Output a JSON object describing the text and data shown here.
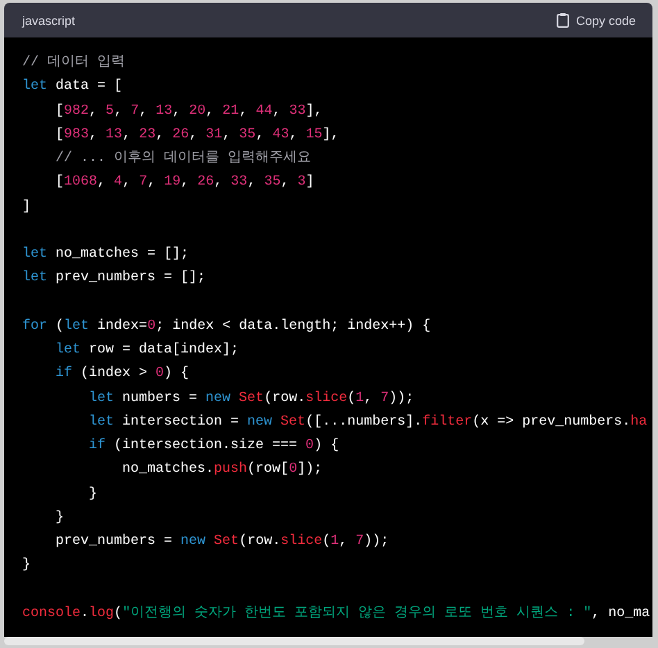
{
  "code_block": {
    "language": "javascript",
    "copy_button": "Copy code",
    "lines": [
      {
        "kind": "code",
        "tokens": [
          {
            "kind": "comment",
            "text": "// 데이터 입력"
          }
        ]
      },
      {
        "kind": "code",
        "tokens": [
          {
            "kind": "keyword",
            "text": "let"
          },
          {
            "kind": "plain",
            "text": " data = ["
          }
        ]
      },
      {
        "kind": "code",
        "tokens": [
          {
            "kind": "plain",
            "text": "    ["
          },
          {
            "kind": "number",
            "text": "982"
          },
          {
            "kind": "plain",
            "text": ", "
          },
          {
            "kind": "number",
            "text": "5"
          },
          {
            "kind": "plain",
            "text": ", "
          },
          {
            "kind": "number",
            "text": "7"
          },
          {
            "kind": "plain",
            "text": ", "
          },
          {
            "kind": "number",
            "text": "13"
          },
          {
            "kind": "plain",
            "text": ", "
          },
          {
            "kind": "number",
            "text": "20"
          },
          {
            "kind": "plain",
            "text": ", "
          },
          {
            "kind": "number",
            "text": "21"
          },
          {
            "kind": "plain",
            "text": ", "
          },
          {
            "kind": "number",
            "text": "44"
          },
          {
            "kind": "plain",
            "text": ", "
          },
          {
            "kind": "number",
            "text": "33"
          },
          {
            "kind": "plain",
            "text": "],"
          }
        ]
      },
      {
        "kind": "code",
        "tokens": [
          {
            "kind": "plain",
            "text": "    ["
          },
          {
            "kind": "number",
            "text": "983"
          },
          {
            "kind": "plain",
            "text": ", "
          },
          {
            "kind": "number",
            "text": "13"
          },
          {
            "kind": "plain",
            "text": ", "
          },
          {
            "kind": "number",
            "text": "23"
          },
          {
            "kind": "plain",
            "text": ", "
          },
          {
            "kind": "number",
            "text": "26"
          },
          {
            "kind": "plain",
            "text": ", "
          },
          {
            "kind": "number",
            "text": "31"
          },
          {
            "kind": "plain",
            "text": ", "
          },
          {
            "kind": "number",
            "text": "35"
          },
          {
            "kind": "plain",
            "text": ", "
          },
          {
            "kind": "number",
            "text": "43"
          },
          {
            "kind": "plain",
            "text": ", "
          },
          {
            "kind": "number",
            "text": "15"
          },
          {
            "kind": "plain",
            "text": "],"
          }
        ]
      },
      {
        "kind": "code",
        "tokens": [
          {
            "kind": "comment",
            "text": "    // ... 이후의 데이터를 입력해주세요"
          }
        ]
      },
      {
        "kind": "code",
        "tokens": [
          {
            "kind": "plain",
            "text": "    ["
          },
          {
            "kind": "number",
            "text": "1068"
          },
          {
            "kind": "plain",
            "text": ", "
          },
          {
            "kind": "number",
            "text": "4"
          },
          {
            "kind": "plain",
            "text": ", "
          },
          {
            "kind": "number",
            "text": "7"
          },
          {
            "kind": "plain",
            "text": ", "
          },
          {
            "kind": "number",
            "text": "19"
          },
          {
            "kind": "plain",
            "text": ", "
          },
          {
            "kind": "number",
            "text": "26"
          },
          {
            "kind": "plain",
            "text": ", "
          },
          {
            "kind": "number",
            "text": "33"
          },
          {
            "kind": "plain",
            "text": ", "
          },
          {
            "kind": "number",
            "text": "35"
          },
          {
            "kind": "plain",
            "text": ", "
          },
          {
            "kind": "number",
            "text": "3"
          },
          {
            "kind": "plain",
            "text": "]"
          }
        ]
      },
      {
        "kind": "code",
        "tokens": [
          {
            "kind": "plain",
            "text": "]"
          }
        ]
      },
      {
        "kind": "blank"
      },
      {
        "kind": "code",
        "tokens": [
          {
            "kind": "keyword",
            "text": "let"
          },
          {
            "kind": "plain",
            "text": " no_matches = [];"
          }
        ]
      },
      {
        "kind": "code",
        "tokens": [
          {
            "kind": "keyword",
            "text": "let"
          },
          {
            "kind": "plain",
            "text": " prev_numbers = [];"
          }
        ]
      },
      {
        "kind": "blank"
      },
      {
        "kind": "code",
        "tokens": [
          {
            "kind": "keyword",
            "text": "for"
          },
          {
            "kind": "plain",
            "text": " ("
          },
          {
            "kind": "keyword",
            "text": "let"
          },
          {
            "kind": "plain",
            "text": " index="
          },
          {
            "kind": "number",
            "text": "0"
          },
          {
            "kind": "plain",
            "text": "; index < data.length; index++) {"
          }
        ]
      },
      {
        "kind": "code",
        "tokens": [
          {
            "kind": "keyword",
            "text": "    let"
          },
          {
            "kind": "plain",
            "text": " row = data[index];"
          }
        ]
      },
      {
        "kind": "code",
        "tokens": [
          {
            "kind": "keyword",
            "text": "    if"
          },
          {
            "kind": "plain",
            "text": " (index > "
          },
          {
            "kind": "number",
            "text": "0"
          },
          {
            "kind": "plain",
            "text": ") {"
          }
        ]
      },
      {
        "kind": "code",
        "tokens": [
          {
            "kind": "keyword",
            "text": "        let"
          },
          {
            "kind": "plain",
            "text": " numbers = "
          },
          {
            "kind": "keyword",
            "text": "new "
          },
          {
            "kind": "function",
            "text": "Set"
          },
          {
            "kind": "plain",
            "text": "(row."
          },
          {
            "kind": "function",
            "text": "slice"
          },
          {
            "kind": "plain",
            "text": "("
          },
          {
            "kind": "number",
            "text": "1"
          },
          {
            "kind": "plain",
            "text": ", "
          },
          {
            "kind": "number",
            "text": "7"
          },
          {
            "kind": "plain",
            "text": "));"
          }
        ]
      },
      {
        "kind": "code",
        "tokens": [
          {
            "kind": "keyword",
            "text": "        let"
          },
          {
            "kind": "plain",
            "text": " intersection = "
          },
          {
            "kind": "keyword",
            "text": "new "
          },
          {
            "kind": "function",
            "text": "Set"
          },
          {
            "kind": "plain",
            "text": "([...numbers]."
          },
          {
            "kind": "function",
            "text": "filter"
          },
          {
            "kind": "plain",
            "text": "(x => prev_numbers."
          },
          {
            "kind": "function",
            "text": "ha"
          }
        ]
      },
      {
        "kind": "code",
        "tokens": [
          {
            "kind": "keyword",
            "text": "        if"
          },
          {
            "kind": "plain",
            "text": " (intersection.size === "
          },
          {
            "kind": "number",
            "text": "0"
          },
          {
            "kind": "plain",
            "text": ") {"
          }
        ]
      },
      {
        "kind": "code",
        "tokens": [
          {
            "kind": "plain",
            "text": "            no_matches."
          },
          {
            "kind": "function",
            "text": "push"
          },
          {
            "kind": "plain",
            "text": "(row["
          },
          {
            "kind": "number",
            "text": "0"
          },
          {
            "kind": "plain",
            "text": "]);"
          }
        ]
      },
      {
        "kind": "code",
        "tokens": [
          {
            "kind": "plain",
            "text": "        }"
          }
        ]
      },
      {
        "kind": "code",
        "tokens": [
          {
            "kind": "plain",
            "text": "    }"
          }
        ]
      },
      {
        "kind": "code",
        "tokens": [
          {
            "kind": "plain",
            "text": "    prev_numbers = "
          },
          {
            "kind": "keyword",
            "text": "new "
          },
          {
            "kind": "function",
            "text": "Set"
          },
          {
            "kind": "plain",
            "text": "(row."
          },
          {
            "kind": "function",
            "text": "slice"
          },
          {
            "kind": "plain",
            "text": "("
          },
          {
            "kind": "number",
            "text": "1"
          },
          {
            "kind": "plain",
            "text": ", "
          },
          {
            "kind": "number",
            "text": "7"
          },
          {
            "kind": "plain",
            "text": "));"
          }
        ]
      },
      {
        "kind": "code",
        "tokens": [
          {
            "kind": "plain",
            "text": "}"
          }
        ]
      },
      {
        "kind": "blank"
      },
      {
        "kind": "code",
        "tokens": [
          {
            "kind": "function",
            "text": "console"
          },
          {
            "kind": "plain",
            "text": "."
          },
          {
            "kind": "function",
            "text": "log"
          },
          {
            "kind": "plain",
            "text": "("
          },
          {
            "kind": "string",
            "text": "\"이전행의 숫자가 한번도 포함되지 않은 경우의 로또 번호 시퀀스 : \""
          },
          {
            "kind": "plain",
            "text": ", no_ma"
          }
        ]
      }
    ]
  }
}
